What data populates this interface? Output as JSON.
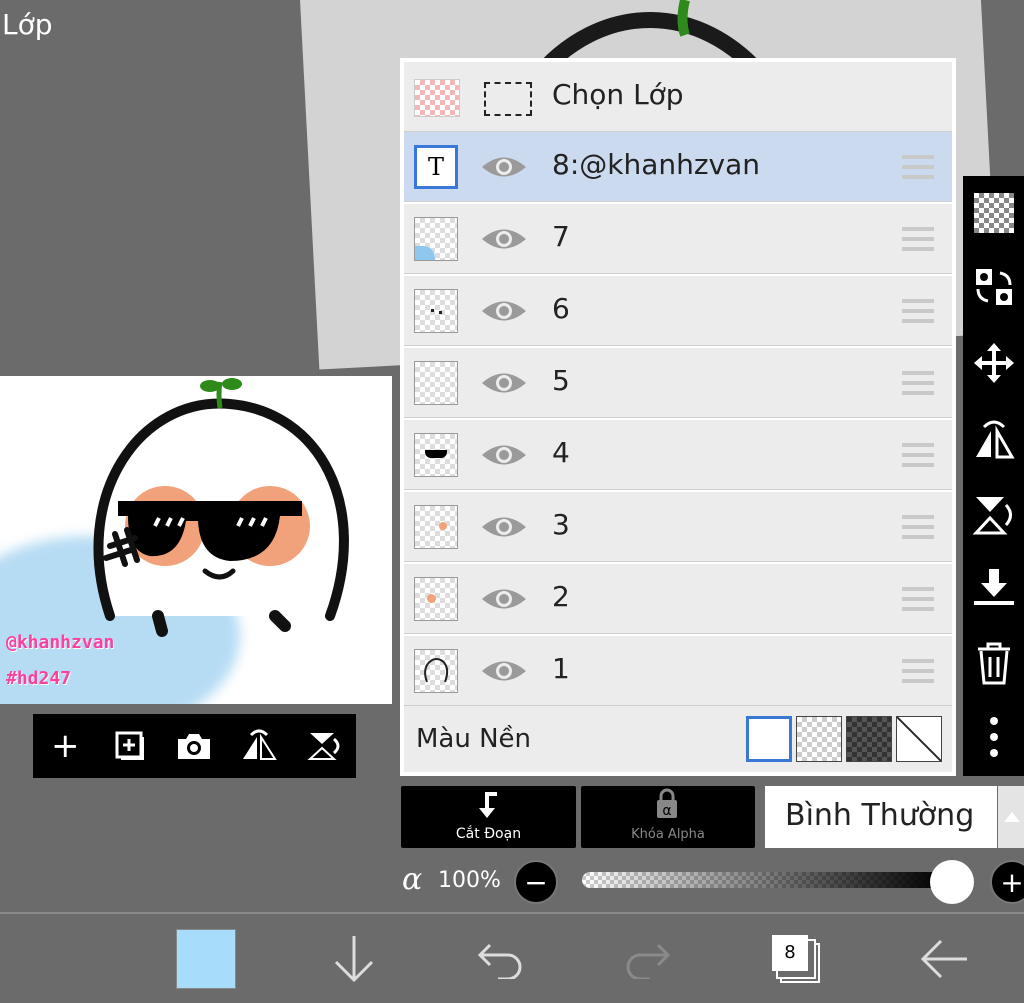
{
  "screen": {
    "title": "Lớp"
  },
  "preview": {
    "tags": [
      "@khanhzvan",
      "#hd247"
    ],
    "toolbar": [
      "add-layer-icon",
      "add-copy-icon",
      "camera-icon",
      "flip-horizontal-icon",
      "flip-vertical-icon"
    ]
  },
  "layers": {
    "select_label": "Chọn Lớp",
    "items": [
      {
        "name": "8:@khanhzvan",
        "thumb": "text-T",
        "selected": true
      },
      {
        "name": "7",
        "thumb": "blue-corner"
      },
      {
        "name": "6",
        "thumb": "dots"
      },
      {
        "name": "5",
        "thumb": "blank"
      },
      {
        "name": "4",
        "thumb": "sunglasses"
      },
      {
        "name": "3",
        "thumb": "orange-dot"
      },
      {
        "name": "2",
        "thumb": "orange-dot"
      },
      {
        "name": "1",
        "thumb": "outline"
      }
    ],
    "background_label": "Màu Nền"
  },
  "actions": {
    "clipping_label": "Cắt Đoạn",
    "alpha_lock_label": "Khóa Alpha",
    "blend_mode": "Bình Thường"
  },
  "opacity": {
    "symbol": "α",
    "value_label": "100%",
    "value": 100,
    "minus": "−",
    "plus": "+"
  },
  "bottom_bar": {
    "layer_count": "8",
    "color": "#a8dcfb"
  },
  "colors": {
    "selection": "#ccdaf0",
    "accent": "#3a78d8",
    "tag": "#ff3fa0"
  }
}
